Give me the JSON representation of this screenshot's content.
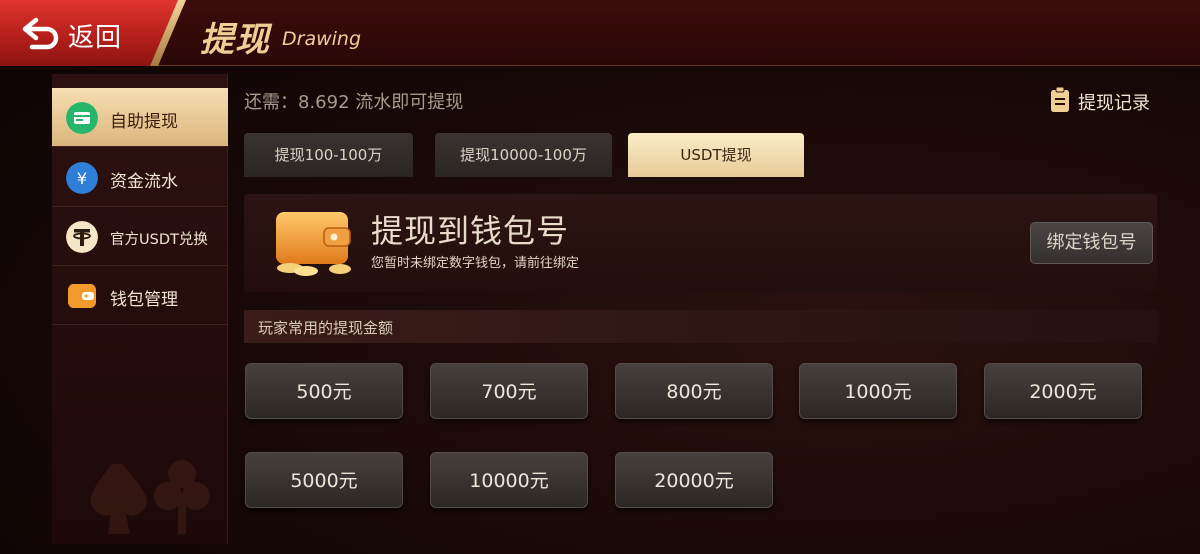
{
  "header": {
    "back_label": "返回",
    "title": "提现",
    "title_en": "Drawing"
  },
  "sidebar": {
    "items": [
      {
        "label": "自助提现",
        "icon": "withdraw-card-icon",
        "active": true
      },
      {
        "label": "资金流水",
        "icon": "yuan-coin-icon",
        "active": false
      },
      {
        "label": "官方USDT兑换",
        "icon": "tether-icon",
        "active": false
      },
      {
        "label": "钱包管理",
        "icon": "wallet-icon",
        "active": false
      }
    ]
  },
  "main": {
    "remaining_text": "还需：8.692 流水即可提现",
    "record_label": "提现记录",
    "tabs": [
      {
        "label": "提现100-100万",
        "active": false
      },
      {
        "label": "提现10000-100万",
        "active": false
      },
      {
        "label": "USDT提现",
        "active": true
      }
    ],
    "wallet": {
      "title": "提现到钱包号",
      "subtitle": "您暂时未绑定数字钱包，请前往绑定",
      "bind_button": "绑定钱包号"
    },
    "common_amounts_label": "玩家常用的提现金额",
    "amounts": [
      "500元",
      "700元",
      "800元",
      "1000元",
      "2000元",
      "5000元",
      "10000元",
      "20000元"
    ]
  },
  "colors": {
    "accent_gold": "#f0cf96",
    "back_red": "#c9251f",
    "active_tab": "#f3e0b4"
  }
}
